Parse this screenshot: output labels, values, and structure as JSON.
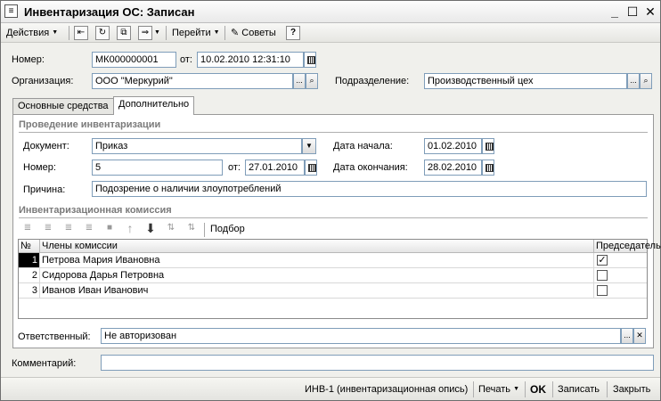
{
  "window": {
    "title": "Инвентаризация ОС: Записан",
    "icon": "document-icon"
  },
  "toolbar": {
    "actions_label": "Действия",
    "goto_label": "Перейти",
    "tips_label": "Советы",
    "help_label": "?"
  },
  "header": {
    "number_label": "Номер:",
    "number_value": "МК000000001",
    "from_label": "от:",
    "date_value": "10.02.2010 12:31:10",
    "org_label": "Организация:",
    "org_value": "ООО \"Меркурий\"",
    "dept_label": "Подразделение:",
    "dept_value": "Производственный цех"
  },
  "tabs": [
    {
      "label": "Основные средства"
    },
    {
      "label": "Дополнительно"
    }
  ],
  "conduct": {
    "title": "Проведение инвентаризации",
    "doc_label": "Документ:",
    "doc_value": "Приказ",
    "start_label": "Дата начала:",
    "start_value": "01.02.2010",
    "number_label": "Номер:",
    "number_value": "5",
    "from_label": "от:",
    "from_value": "27.01.2010",
    "end_label": "Дата окончания:",
    "end_value": "28.02.2010",
    "reason_label": "Причина:",
    "reason_value": "Подозрение о наличии злоупотреблений"
  },
  "commission": {
    "title": "Инвентаризационная комиссия",
    "pick_label": "Подбор",
    "columns": {
      "num": "№",
      "member": "Члены комиссии",
      "chair": "Председатель"
    },
    "rows": [
      {
        "num": "1",
        "member": "Петрова  Мария Ивановна",
        "chair": true
      },
      {
        "num": "2",
        "member": "Сидорова  Дарья Петровна",
        "chair": false
      },
      {
        "num": "3",
        "member": "Иванов Иван Иванович",
        "chair": false
      }
    ]
  },
  "responsible": {
    "label": "Ответственный:",
    "value": "Не авторизован"
  },
  "comment": {
    "label": "Комментарий:",
    "value": ""
  },
  "footer": {
    "inv1_label": "ИНВ-1 (инвентаризационная опись)",
    "print_label": "Печать",
    "ok_label": "OK",
    "save_label": "Записать",
    "close_label": "Закрыть"
  }
}
